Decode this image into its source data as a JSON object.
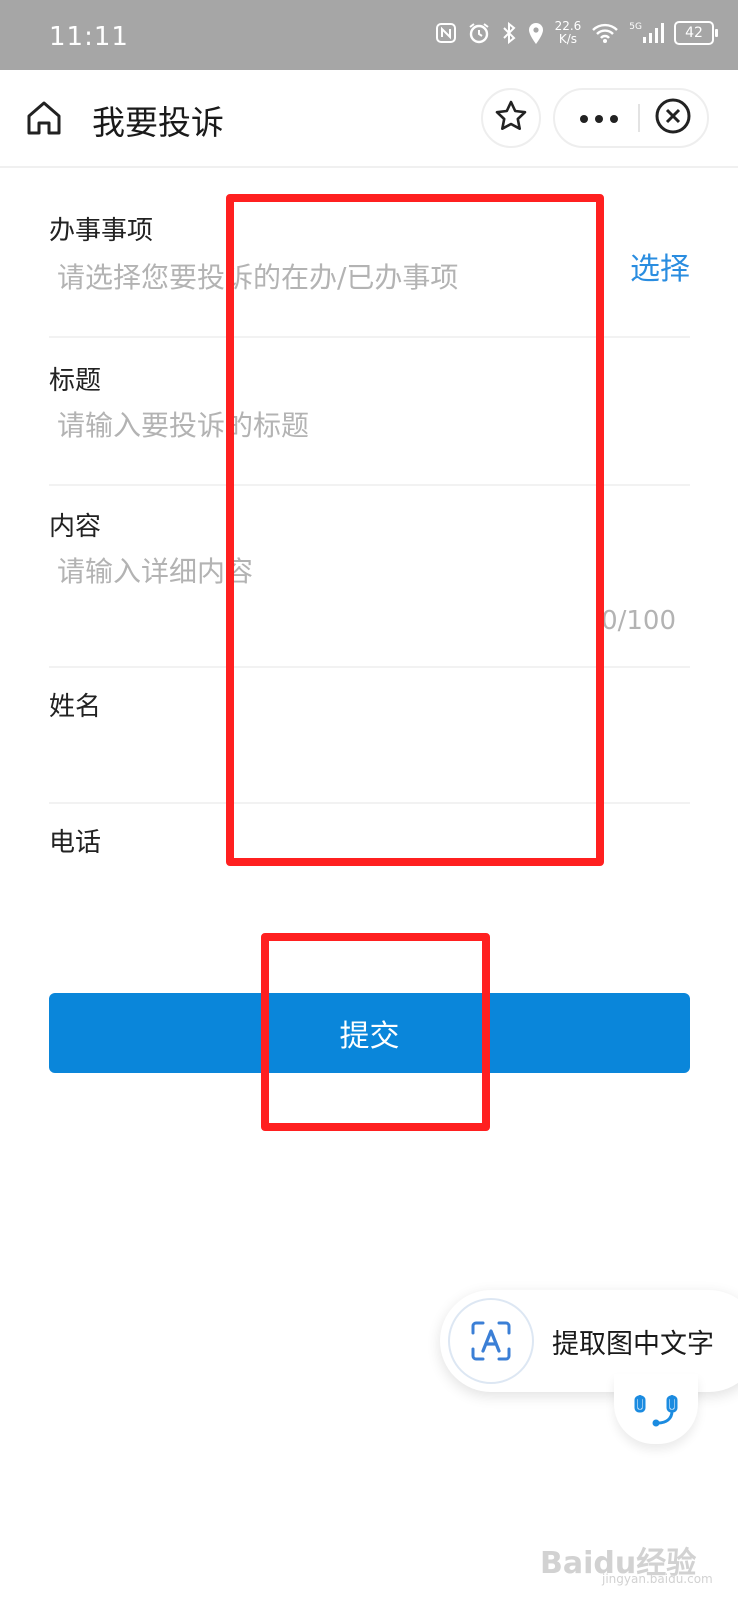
{
  "status_bar": {
    "time": "11:11",
    "net_speed_value": "22.6",
    "net_speed_unit": "K/s",
    "signal_label": "5G",
    "battery": "42"
  },
  "navbar": {
    "title": "我要投诉"
  },
  "form": {
    "matter_label": "办事事项",
    "matter_placeholder": "请选择您要投诉的在办/已办事项",
    "matter_select": "选择",
    "title_label": "标题",
    "title_placeholder": "请输入要投诉的标题",
    "content_label": "内容",
    "content_placeholder": "请输入详细内容",
    "content_counter": "0/100",
    "name_label": "姓名",
    "phone_label": "电话"
  },
  "submit_label": "提交",
  "ocr_button_label": "提取图中文字",
  "colors": {
    "accent": "#0a86da",
    "highlight_box": "#ff2020",
    "status_bar": "#a6a6a6"
  },
  "icons": [
    "home-icon",
    "star-icon",
    "more-icon",
    "close-circle-icon",
    "text-recognition-icon",
    "customer-service-icon"
  ],
  "watermark": {
    "logo": "Baidu经验",
    "url": "jingyan.baidu.com"
  }
}
